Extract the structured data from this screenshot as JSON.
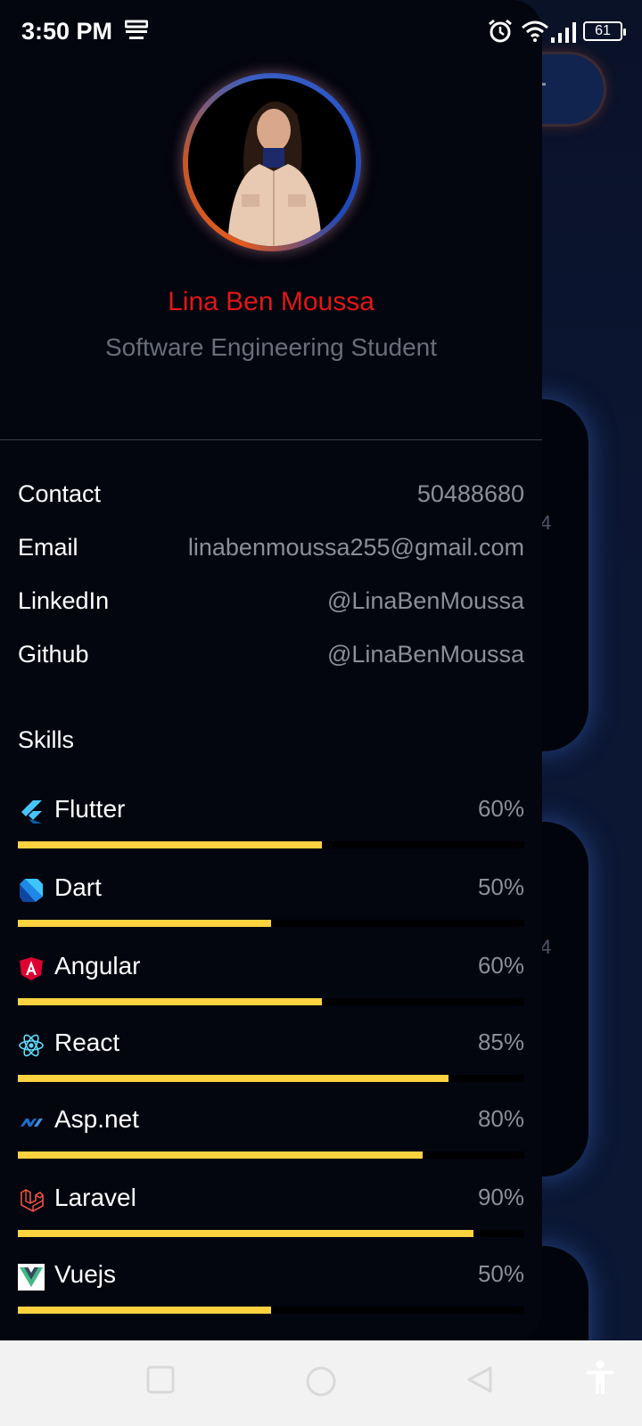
{
  "status_bar": {
    "time": "3:50 PM",
    "battery": "61",
    "icons": [
      "notification-list-icon",
      "alarm-icon",
      "wifi-icon",
      "signal-icon",
      "battery-icon"
    ]
  },
  "profile": {
    "name": "Lina Ben Moussa",
    "role": "Software Engineering Student"
  },
  "contact_info": [
    {
      "label": "Contact",
      "value": "50488680"
    },
    {
      "label": "Email",
      "value": "linabenmoussa255@gmail.com"
    },
    {
      "label": "LinkedIn",
      "value": "@LinaBenMoussa"
    },
    {
      "label": "Github",
      "value": "@LinaBenMoussa"
    }
  ],
  "skills_title": "Skills",
  "skills": [
    {
      "name": "Flutter",
      "percent_label": "60%",
      "level": 0.6,
      "icon": "flutter-icon"
    },
    {
      "name": "Dart",
      "percent_label": "50%",
      "level": 0.5,
      "icon": "dart-icon"
    },
    {
      "name": "Angular",
      "percent_label": "60%",
      "level": 0.6,
      "icon": "angular-icon"
    },
    {
      "name": "React",
      "percent_label": "85%",
      "level": 0.85,
      "icon": "react-icon"
    },
    {
      "name": "Asp.net",
      "percent_label": "80%",
      "level": 0.8,
      "icon": "aspnet-icon"
    },
    {
      "name": "Laravel",
      "percent_label": "90%",
      "level": 0.9,
      "icon": "laravel-icon"
    },
    {
      "name": "Vuejs",
      "percent_label": "50%",
      "level": 0.5,
      "icon": "vuejs-icon"
    }
  ],
  "background_cards": [
    {
      "digit": "4"
    },
    {
      "digit": "4"
    }
  ],
  "colors": {
    "drawer_bg": "#03050f",
    "name_red": "#e31616",
    "progress_fill": "#ffd23f",
    "muted_text": "#8b8f99"
  },
  "nav_bar": {
    "buttons": [
      "recents-button",
      "home-button",
      "back-button",
      "accessibility-button"
    ]
  }
}
